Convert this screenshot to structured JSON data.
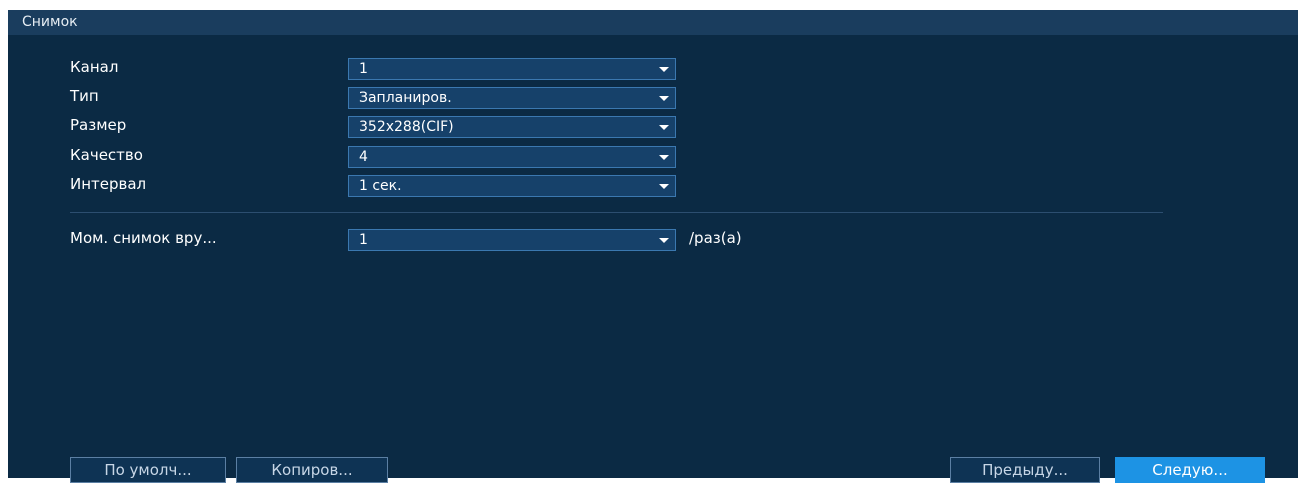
{
  "window": {
    "title": "Снимок"
  },
  "form": {
    "channel": {
      "label": "Канал",
      "value": "1"
    },
    "type": {
      "label": "Тип",
      "value": "Запланиров."
    },
    "size": {
      "label": "Размер",
      "value": "352x288(CIF)"
    },
    "quality": {
      "label": "Качество",
      "value": "4"
    },
    "interval": {
      "label": "Интервал",
      "value": "1 сек."
    },
    "manual_snapshot": {
      "label": "Мом. снимок вру...",
      "value": "1",
      "unit": "/раз(а)"
    }
  },
  "buttons": {
    "default": "По умолч...",
    "copy": "Копиров...",
    "prev": "Предыду...",
    "next": "Следую..."
  },
  "colors": {
    "panel_bg": "#0b2a44",
    "titlebar_bg": "#1a3d5e",
    "select_bg": "#16416a",
    "select_border": "#3b78b0",
    "accent": "#1d93e4"
  },
  "icons": {
    "dropdown": "chevron-down-icon"
  }
}
